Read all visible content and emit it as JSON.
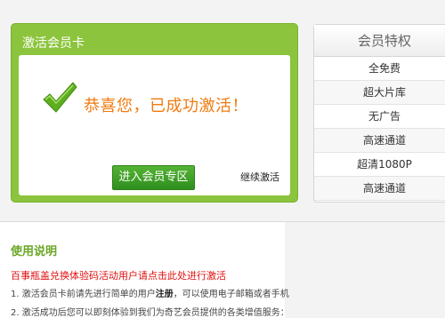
{
  "card": {
    "title": "激活会员卡",
    "message": "恭喜您，已成功激活！",
    "enter_button": "进入会员专区",
    "continue_link": "继续激活"
  },
  "benefits": {
    "title": "会员特权",
    "items": [
      "全免费",
      "超大片库",
      "无广告",
      "高速通道",
      "超清1080P",
      "高速通道"
    ]
  },
  "instructions": {
    "title": "使用说明",
    "red_link": "百事瓶盖兑换体验码活动用户请点击此处进行激活",
    "line1_prefix": "1. 激活会员卡前请先进行简单的用户",
    "line1_link": "注册",
    "line1_suffix": "，可以使用电子邮箱或者手机",
    "line2": "2. 激活成功后您可以即刻体验到我们为奇艺会员提供的各类增值服务："
  },
  "colors": {
    "accent_green": "#8cc53d",
    "success_orange": "#f07a10",
    "button_green": "#3a9b25",
    "link_red": "#e01010"
  },
  "icons": {
    "check": "checkmark-icon"
  }
}
